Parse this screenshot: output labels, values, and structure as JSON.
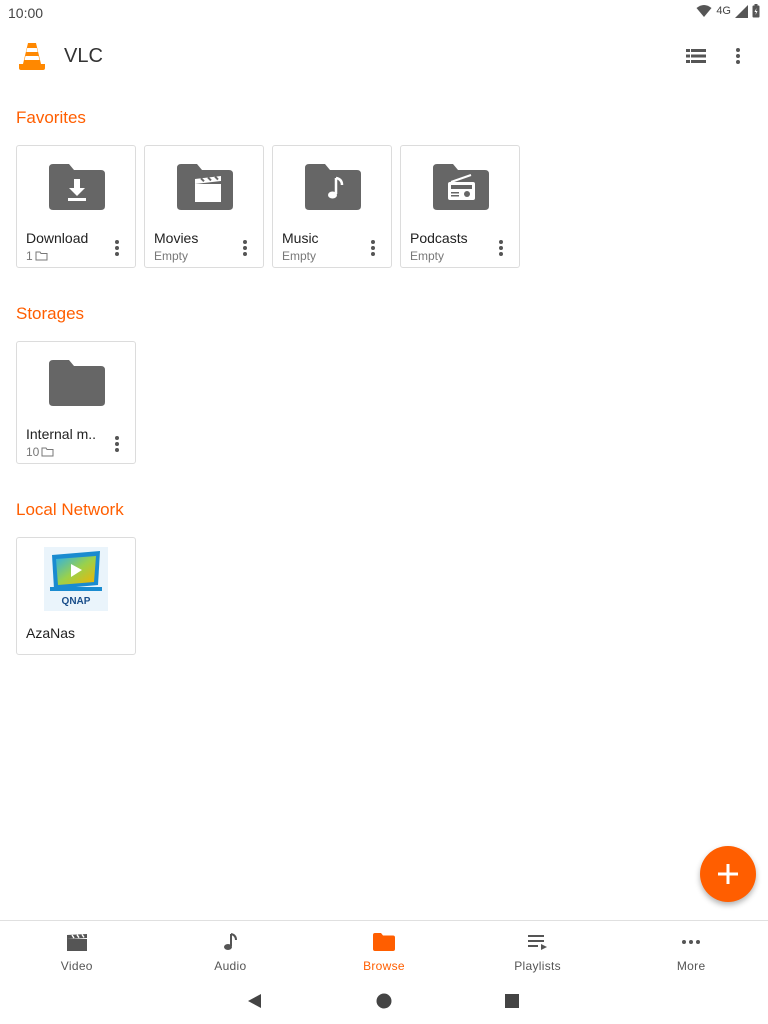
{
  "status": {
    "time": "10:00",
    "network": "4G"
  },
  "toolbar": {
    "title": "VLC"
  },
  "sections": {
    "favorites": {
      "title": "Favorites",
      "items": [
        {
          "title": "Download",
          "subtitle": "1"
        },
        {
          "title": "Movies",
          "subtitle": "Empty"
        },
        {
          "title": "Music",
          "subtitle": "Empty"
        },
        {
          "title": "Podcasts",
          "subtitle": "Empty"
        }
      ]
    },
    "storages": {
      "title": "Storages",
      "items": [
        {
          "title": "Internal m..",
          "subtitle": "10"
        }
      ]
    },
    "network": {
      "title": "Local Network",
      "items": [
        {
          "title": "AzaNas",
          "logo_text": "QNAP"
        }
      ]
    }
  },
  "bottom_nav": {
    "items": [
      {
        "label": "Video"
      },
      {
        "label": "Audio"
      },
      {
        "label": "Browse"
      },
      {
        "label": "Playlists"
      },
      {
        "label": "More"
      }
    ],
    "active": "Browse"
  },
  "colors": {
    "accent": "#ff5e00",
    "icon": "#666666",
    "text": "#212121",
    "subtext": "#777777"
  },
  "icons": {
    "fav_download": "folder-download-icon",
    "fav_movies": "folder-movies-icon",
    "fav_music": "folder-music-icon",
    "fav_podcasts": "folder-podcast-icon",
    "storage": "folder-icon",
    "network": "qnap-nas-logo"
  }
}
